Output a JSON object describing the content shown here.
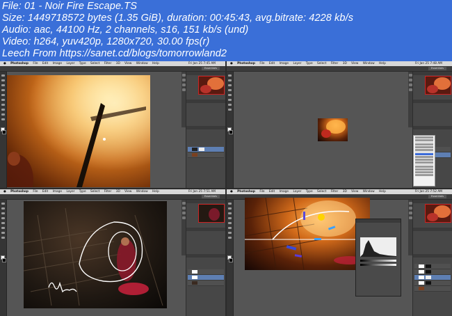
{
  "info": {
    "line1": "File: 01 - Noir Fire Escape.TS",
    "line2": "Size: 1449718572 bytes (1.35 GiB), duration: 00:45:43, avg.bitrate: 4228 kb/s",
    "line3": "Audio: aac, 44100 Hz, 2 channels, s16, 151 kb/s (und)",
    "line4": "Video: h264, yuv420p, 1280x720, 30.00 fps(r)",
    "line5": "Leech From https://sanet.cd/blogs/tomorrowland2"
  },
  "app": {
    "name": "Photoshop",
    "menus": [
      "File",
      "Edit",
      "Image",
      "Layer",
      "Type",
      "Select",
      "Filter",
      "3D",
      "View",
      "Window",
      "Help"
    ],
    "clock_tl": "Fri Jan 25 7:45 AM",
    "clock_tr": "Fri Jan 25 7:48 AM",
    "clock_bl": "Fri Jan 25 7:51 AM",
    "clock_br": "Fri Jan 25 7:52 AM",
    "workspace": "Essentials"
  },
  "colors": {
    "background": "#3a6fd8",
    "info_text": "#ffffff",
    "grid_gap": "#2b2b2b",
    "ps_canvas_bg": "#555555",
    "ps_panel": "#474747",
    "nav_frame": "#cc2222",
    "layer_selected": "#5e7fb3",
    "menu_highlight": "#3b6ad8",
    "arc_stroke": "#ffffff",
    "accent_purple": "#5a4ad8",
    "accent_blue": "#3aa0ff",
    "accent_yellow": "#ffd400"
  },
  "icons": [
    "apple-icon",
    "tool-icon",
    "swatch-icon",
    "panel-icon",
    "layer-thumbnail",
    "layer-mask-thumbnail"
  ]
}
